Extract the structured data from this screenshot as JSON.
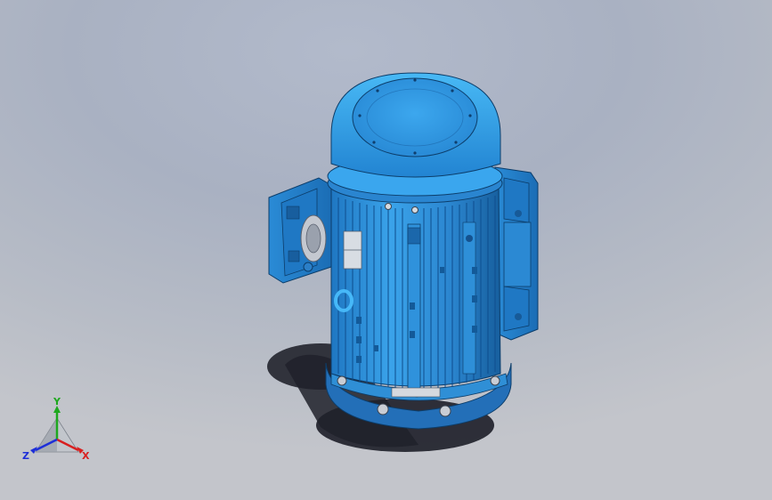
{
  "triad": {
    "x_label": "X",
    "y_label": "Y",
    "z_label": "Z",
    "x_color": "#d82020",
    "y_color": "#1ea81e",
    "z_color": "#1e2fd8"
  },
  "model": {
    "body_color": "#2f8fd6",
    "highlight_color": "#3fb0f0",
    "shadow_color": "#0f4f8f",
    "drop_shadow_color": "#1e1f2a"
  }
}
